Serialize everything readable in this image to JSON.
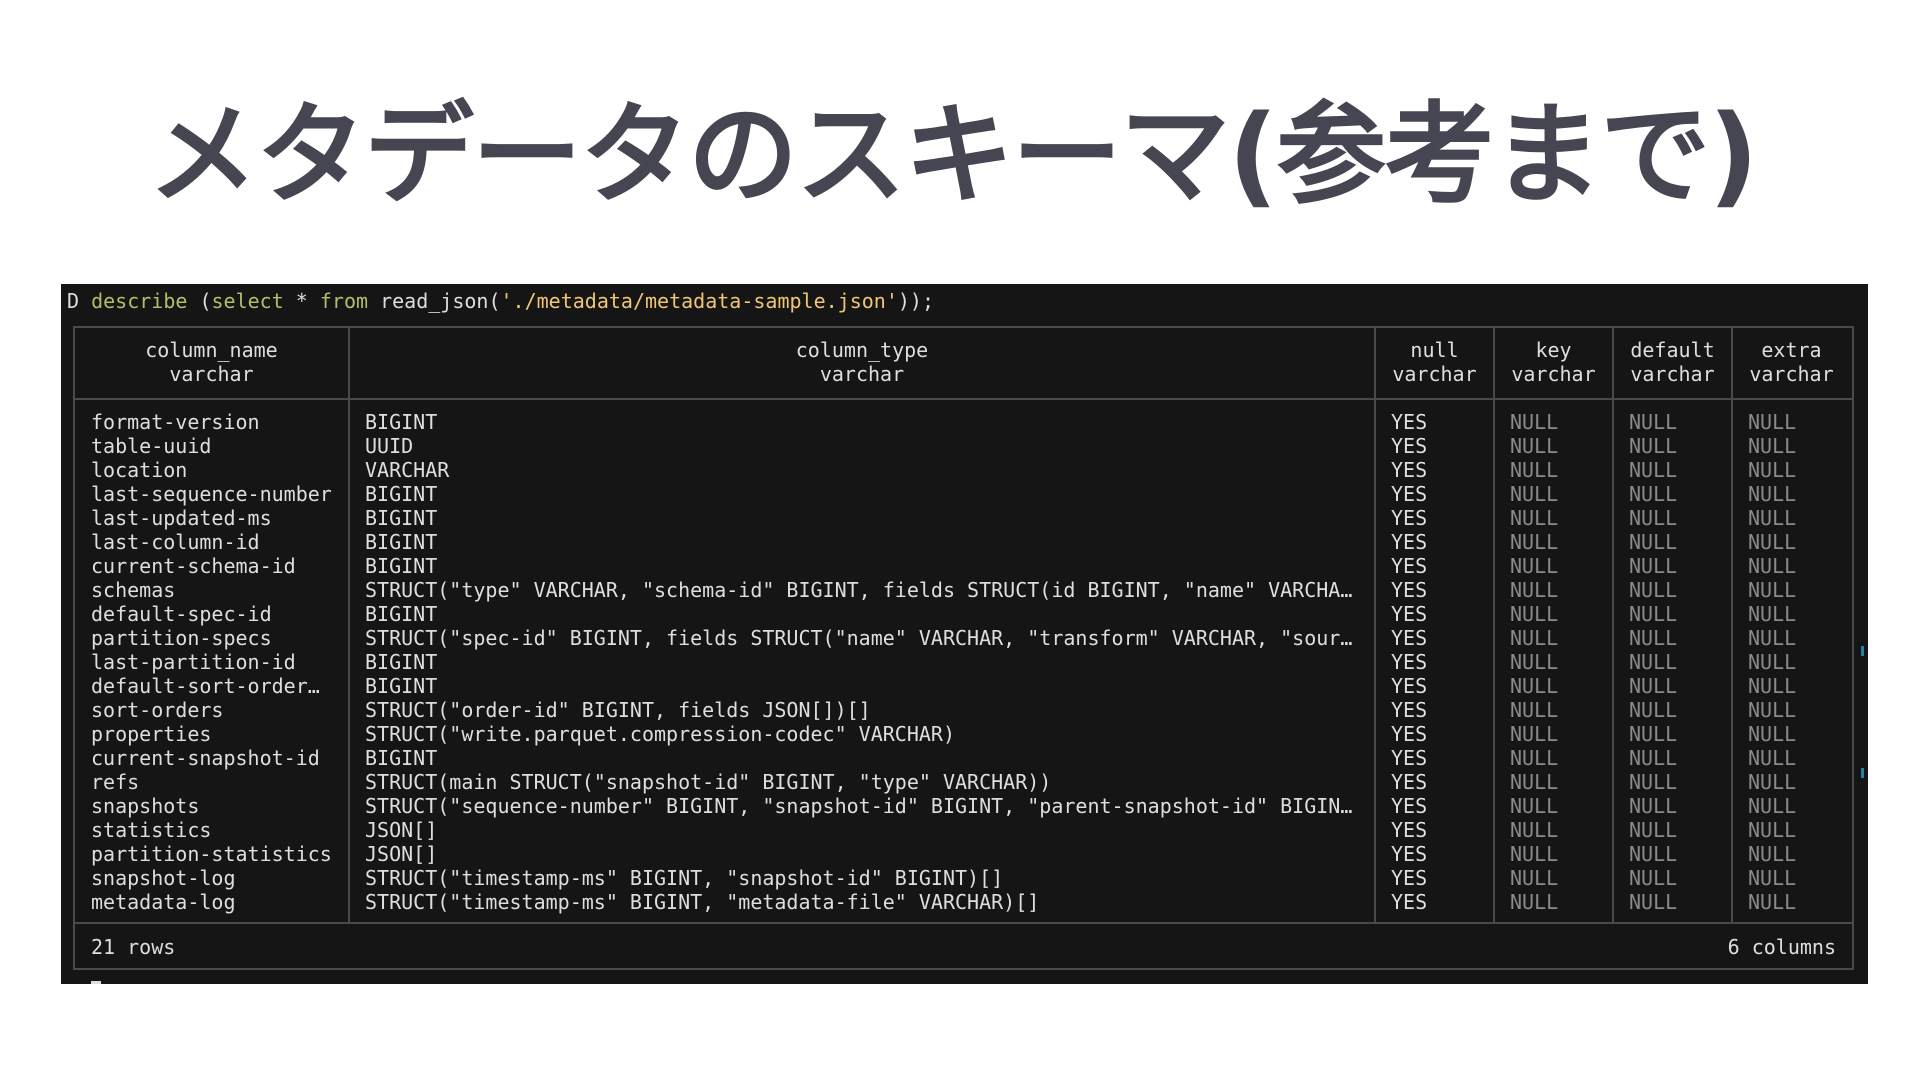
{
  "slide": {
    "title": "メタデータのスキーマ(参考まで)"
  },
  "terminal": {
    "command": {
      "prompt": "D ",
      "describe": "describe",
      "open": " (",
      "select": "select",
      "star": " * ",
      "from": "from",
      "fn": " read_json(",
      "path": "'./metadata/metadata-sample.json'",
      "close": "));"
    },
    "table": {
      "headers": [
        "column_name\nvarchar",
        "column_type\nvarchar",
        "null\nvarchar",
        "key\nvarchar",
        "default\nvarchar",
        "extra\nvarchar"
      ],
      "rows": [
        [
          "format-version",
          "BIGINT",
          "YES",
          "NULL",
          "NULL",
          "NULL"
        ],
        [
          "table-uuid",
          "UUID",
          "YES",
          "NULL",
          "NULL",
          "NULL"
        ],
        [
          "location",
          "VARCHAR",
          "YES",
          "NULL",
          "NULL",
          "NULL"
        ],
        [
          "last-sequence-number",
          "BIGINT",
          "YES",
          "NULL",
          "NULL",
          "NULL"
        ],
        [
          "last-updated-ms",
          "BIGINT",
          "YES",
          "NULL",
          "NULL",
          "NULL"
        ],
        [
          "last-column-id",
          "BIGINT",
          "YES",
          "NULL",
          "NULL",
          "NULL"
        ],
        [
          "current-schema-id",
          "BIGINT",
          "YES",
          "NULL",
          "NULL",
          "NULL"
        ],
        [
          "schemas",
          "STRUCT(\"type\" VARCHAR, \"schema-id\" BIGINT, fields STRUCT(id BIGINT, \"name\" VARCHA…",
          "YES",
          "NULL",
          "NULL",
          "NULL"
        ],
        [
          "default-spec-id",
          "BIGINT",
          "YES",
          "NULL",
          "NULL",
          "NULL"
        ],
        [
          "partition-specs",
          "STRUCT(\"spec-id\" BIGINT, fields STRUCT(\"name\" VARCHAR, \"transform\" VARCHAR, \"sour…",
          "YES",
          "NULL",
          "NULL",
          "NULL"
        ],
        [
          "last-partition-id",
          "BIGINT",
          "YES",
          "NULL",
          "NULL",
          "NULL"
        ],
        [
          "default-sort-order…",
          "BIGINT",
          "YES",
          "NULL",
          "NULL",
          "NULL"
        ],
        [
          "sort-orders",
          "STRUCT(\"order-id\" BIGINT, fields JSON[])[]",
          "YES",
          "NULL",
          "NULL",
          "NULL"
        ],
        [
          "properties",
          "STRUCT(\"write.parquet.compression-codec\" VARCHAR)",
          "YES",
          "NULL",
          "NULL",
          "NULL"
        ],
        [
          "current-snapshot-id",
          "BIGINT",
          "YES",
          "NULL",
          "NULL",
          "NULL"
        ],
        [
          "refs",
          "STRUCT(main STRUCT(\"snapshot-id\" BIGINT, \"type\" VARCHAR))",
          "YES",
          "NULL",
          "NULL",
          "NULL"
        ],
        [
          "snapshots",
          "STRUCT(\"sequence-number\" BIGINT, \"snapshot-id\" BIGINT, \"parent-snapshot-id\" BIGIN…",
          "YES",
          "NULL",
          "NULL",
          "NULL"
        ],
        [
          "statistics",
          "JSON[]",
          "YES",
          "NULL",
          "NULL",
          "NULL"
        ],
        [
          "partition-statistics",
          "JSON[]",
          "YES",
          "NULL",
          "NULL",
          "NULL"
        ],
        [
          "snapshot-log",
          "STRUCT(\"timestamp-ms\" BIGINT, \"snapshot-id\" BIGINT)[]",
          "YES",
          "NULL",
          "NULL",
          "NULL"
        ],
        [
          "metadata-log",
          "STRUCT(\"timestamp-ms\" BIGINT, \"metadata-file\" VARCHAR)[]",
          "YES",
          "NULL",
          "NULL",
          "NULL"
        ]
      ],
      "footer": {
        "rows_label": "21 rows",
        "columns_label": "6 columns"
      }
    }
  }
}
